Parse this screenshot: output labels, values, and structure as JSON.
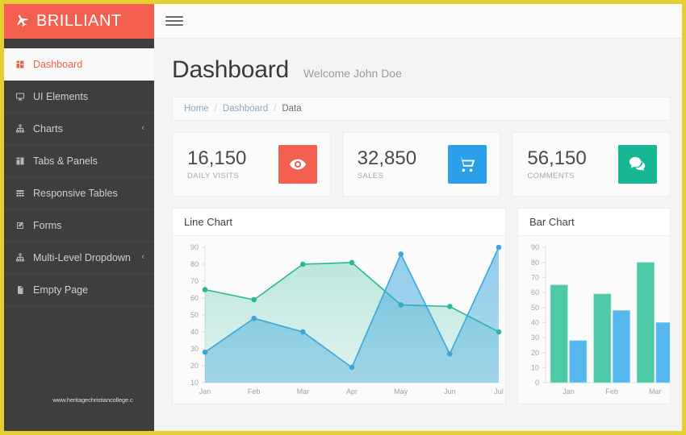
{
  "brand": {
    "name": "BRILLIANT",
    "plane_icon": "plane-icon"
  },
  "sidebar": {
    "watermark": "www.heritagechristiancollege.c",
    "items": [
      {
        "label": "Dashboard",
        "icon": "dashboard-grid-icon",
        "caret": "",
        "active": true
      },
      {
        "label": "UI Elements",
        "icon": "monitor-icon",
        "caret": "",
        "active": false
      },
      {
        "label": "Charts",
        "icon": "sitemap-icon",
        "caret": "‹",
        "active": false
      },
      {
        "label": "Tabs & Panels",
        "icon": "tabs-panels-icon",
        "caret": "",
        "active": false
      },
      {
        "label": "Responsive Tables",
        "icon": "table-icon",
        "caret": "",
        "active": false
      },
      {
        "label": "Forms",
        "icon": "form-edit-icon",
        "caret": "",
        "active": false
      },
      {
        "label": "Multi-Level Dropdown",
        "icon": "sitemap-icon",
        "caret": "‹",
        "active": false
      },
      {
        "label": "Empty Page",
        "icon": "file-icon",
        "caret": "",
        "active": false
      }
    ]
  },
  "topbar": {
    "menu_toggle_icon": "hamburger-icon"
  },
  "header": {
    "title": "Dashboard",
    "welcome": "Welcome John Doe"
  },
  "breadcrumb": {
    "items": [
      {
        "label": "Home",
        "active": false
      },
      {
        "label": "Dashboard",
        "active": false
      },
      {
        "label": "Data",
        "active": true
      }
    ],
    "separator": "/"
  },
  "stats": [
    {
      "value": "16,150",
      "label": "DAILY VISITS",
      "icon": "eye-icon",
      "color": "#f4604f"
    },
    {
      "value": "32,850",
      "label": "SALES",
      "icon": "cart-icon",
      "color": "#2ba0e8"
    },
    {
      "value": "56,150",
      "label": "COMMENTS",
      "icon": "chat-icon",
      "color": "#18b794"
    }
  ],
  "colors": {
    "brand_coral": "#f4604f",
    "blue": "#2ba0e8",
    "teal": "#18b794",
    "series_green": "#28b898",
    "series_blue": "#3aa6dd",
    "sidebar_bg": "#3e3e3e",
    "frame_border": "#e6ce33"
  },
  "chart_data": [
    {
      "type": "line",
      "title": "Line Chart",
      "categories": [
        "Jan",
        "Feb",
        "Mar",
        "Apr",
        "May",
        "Jun",
        "Jul"
      ],
      "series": [
        {
          "name": "green-series",
          "color": "#28b898",
          "values": [
            65,
            59,
            80,
            81,
            56,
            55,
            40
          ]
        },
        {
          "name": "blue-series",
          "color": "#3aa6dd",
          "values": [
            28,
            48,
            40,
            19,
            86,
            27,
            90
          ]
        }
      ],
      "ylim": [
        10,
        90
      ],
      "yticks": [
        10,
        20,
        30,
        40,
        50,
        60,
        70,
        80,
        90
      ],
      "xlabel": "",
      "ylabel": "",
      "grid": false,
      "legend": "none",
      "area_fill": true
    },
    {
      "type": "bar",
      "title": "Bar Chart",
      "categories": [
        "Jan",
        "Feb",
        "Mar"
      ],
      "series": [
        {
          "name": "green-series",
          "color": "#4ec9a8",
          "values": [
            65,
            59,
            80
          ]
        },
        {
          "name": "blue-series",
          "color": "#56b7ee",
          "values": [
            28,
            48,
            40
          ]
        }
      ],
      "ylim": [
        0,
        90
      ],
      "yticks": [
        0,
        10,
        20,
        30,
        40,
        50,
        60,
        70,
        80,
        90
      ],
      "xlabel": "",
      "ylabel": "",
      "grid": false,
      "legend": "none",
      "clipped_right": true
    }
  ]
}
